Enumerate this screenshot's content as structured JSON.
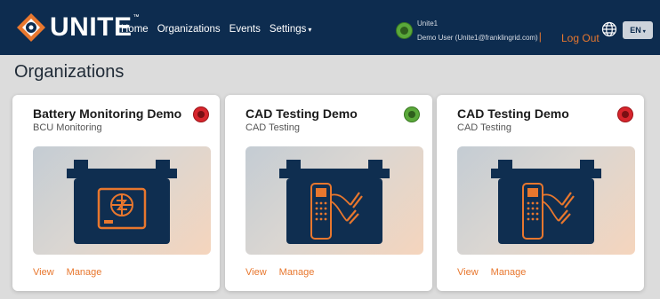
{
  "header": {
    "brand": "UNITE",
    "trademark": "™",
    "nav": [
      {
        "label": "Home"
      },
      {
        "label": "Organizations"
      },
      {
        "label": "Events"
      },
      {
        "label": "Settings"
      }
    ],
    "settings_caret": "▾",
    "user": {
      "org": "Unite1",
      "name": "Demo User (Unite1@franklingrid.com)",
      "separator": "|",
      "logout_label": "Log Out"
    },
    "language": "EN",
    "language_caret": "▾",
    "globe_icon": "globe-icon"
  },
  "page": {
    "title": "Organizations"
  },
  "cards": [
    {
      "title": "Battery Monitoring Demo",
      "subtitle": "BCU Monitoring",
      "status": "red",
      "image": "battery-monitor-icon",
      "view_label": "View",
      "manage_label": "Manage"
    },
    {
      "title": "CAD Testing Demo",
      "subtitle": "CAD Testing",
      "status": "green",
      "image": "battery-tester-icon",
      "view_label": "View",
      "manage_label": "Manage"
    },
    {
      "title": "CAD Testing Demo",
      "subtitle": "CAD Testing",
      "status": "red",
      "image": "battery-tester-icon",
      "view_label": "View",
      "manage_label": "Manage"
    }
  ],
  "colors": {
    "navbar": "#0d2c4f",
    "accent": "#e8772e",
    "status_green": "#5aa83a",
    "status_red": "#d7252c",
    "icon_navy": "#0f2e50"
  }
}
